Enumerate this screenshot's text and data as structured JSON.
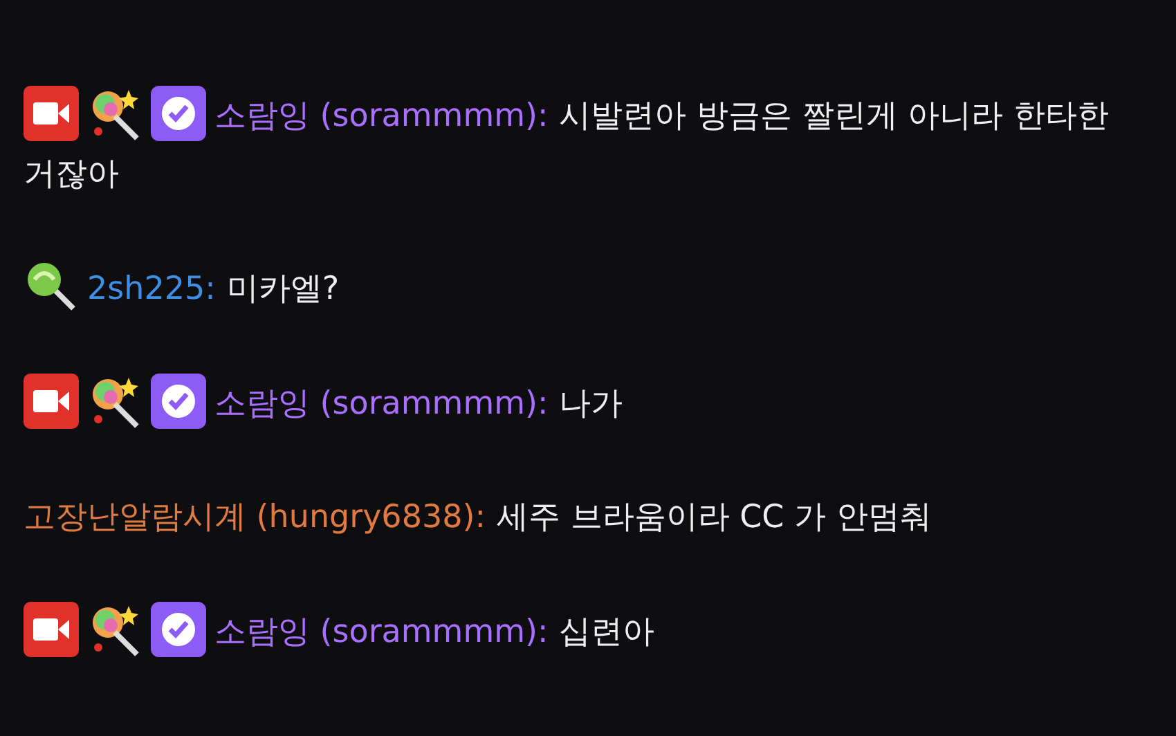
{
  "messages": [
    {
      "badges": [
        {
          "kind": "camera"
        },
        {
          "kind": "wand"
        },
        {
          "kind": "verified"
        }
      ],
      "name": "소람잉 (sorammmm):",
      "color": "#a970ff",
      "lines": [
        "시발련아 방금은 짤린게 아니라 한타한",
        "거잖아"
      ]
    },
    {
      "badges": [
        {
          "kind": "lollipop"
        }
      ],
      "name": "2sh225:",
      "color": "#3e8fe6",
      "lines": [
        "미카엘?"
      ]
    },
    {
      "badges": [
        {
          "kind": "camera"
        },
        {
          "kind": "wand"
        },
        {
          "kind": "verified"
        }
      ],
      "name": "소람잉 (sorammmm):",
      "color": "#a970ff",
      "lines": [
        "나가"
      ]
    },
    {
      "name": "고장난알람시계 (hungry6838):",
      "color": "#e07a41",
      "lines": [
        "세주 브라움이라 CC 가 안멈춰"
      ]
    },
    {
      "badges": [
        {
          "kind": "camera"
        },
        {
          "kind": "wand"
        },
        {
          "kind": "verified"
        }
      ],
      "name": "소람잉 (sorammmm):",
      "color": "#a970ff",
      "lines": [
        "십련아"
      ]
    }
  ]
}
